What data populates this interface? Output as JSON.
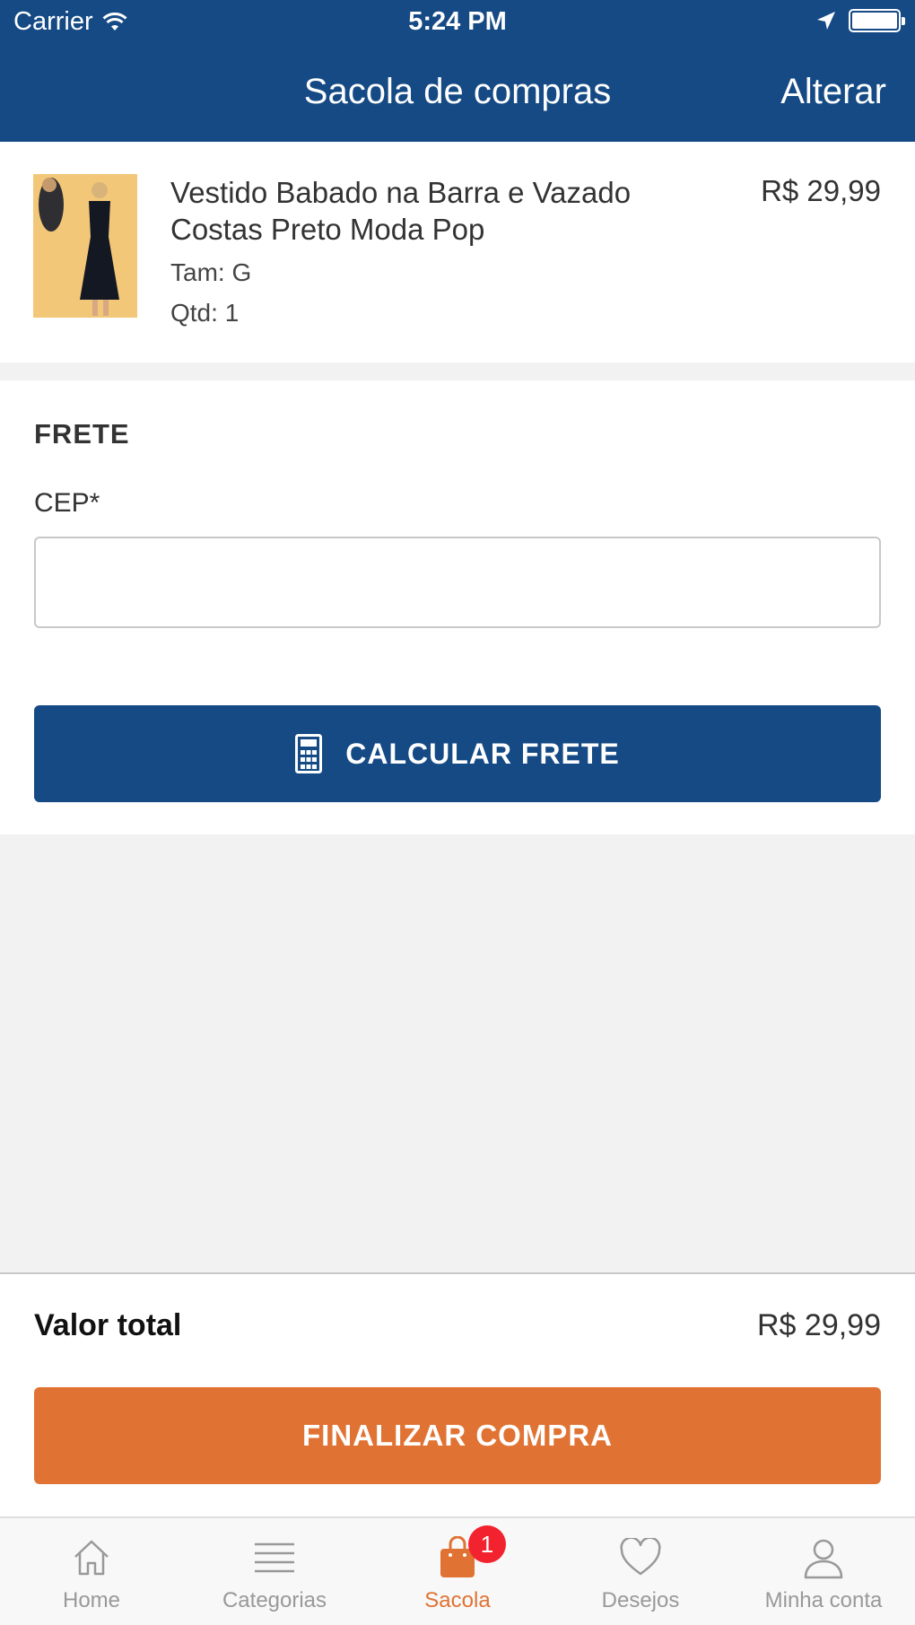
{
  "status_bar": {
    "carrier": "Carrier",
    "time": "5:24 PM"
  },
  "nav": {
    "title": "Sacola de compras",
    "action": "Alterar"
  },
  "cart_item": {
    "name": "Vestido Babado na Barra e Vazado Costas Preto Moda Pop",
    "size": "Tam: G",
    "qty": "Qtd: 1",
    "price": "R$ 29,99"
  },
  "shipping": {
    "title": "FRETE",
    "cep_label": "CEP*",
    "cep_value": "",
    "calc_button": "CALCULAR FRETE"
  },
  "total": {
    "label": "Valor total",
    "value": "R$ 29,99",
    "checkout_button": "FINALIZAR COMPRA"
  },
  "tabs": [
    {
      "label": "Home",
      "icon": "home-icon"
    },
    {
      "label": "Categorias",
      "icon": "list-icon"
    },
    {
      "label": "Sacola",
      "icon": "bag-icon",
      "badge": "1",
      "active": true
    },
    {
      "label": "Desejos",
      "icon": "heart-icon"
    },
    {
      "label": "Minha conta",
      "icon": "person-icon"
    }
  ],
  "colors": {
    "primary": "#154a85",
    "accent": "#e07333",
    "badge": "#f2232f"
  }
}
